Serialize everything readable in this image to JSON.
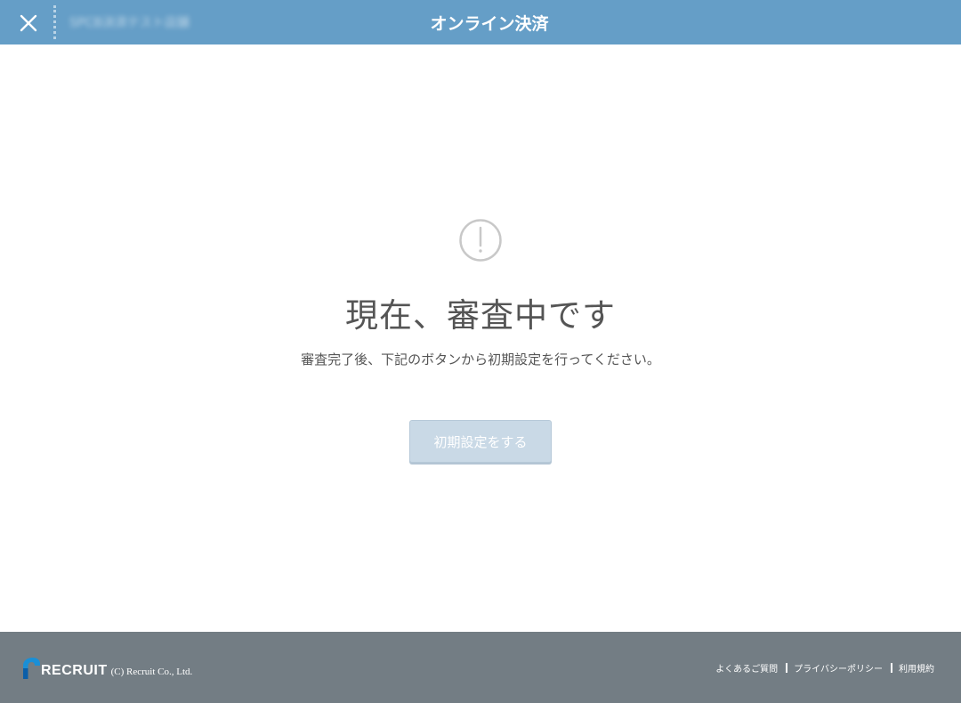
{
  "header": {
    "title": "オンライン決済",
    "store_name": "SPCB決済テスト店舗",
    "background_color": "#659ec7"
  },
  "main": {
    "heading": "現在、審査中です",
    "message": "審査完了後、下記のボタンから初期設定を行ってください。",
    "setup_button_label": "初期設定をする",
    "icon": "alert-circle-icon"
  },
  "footer": {
    "logo_text": "RECRUIT",
    "copyright": "(C) Recruit Co., Ltd.",
    "links": [
      {
        "label": "よくあるご質問"
      },
      {
        "label": "プライバシーポリシー"
      },
      {
        "label": "利用規約"
      }
    ],
    "background_color": "#737d84"
  }
}
